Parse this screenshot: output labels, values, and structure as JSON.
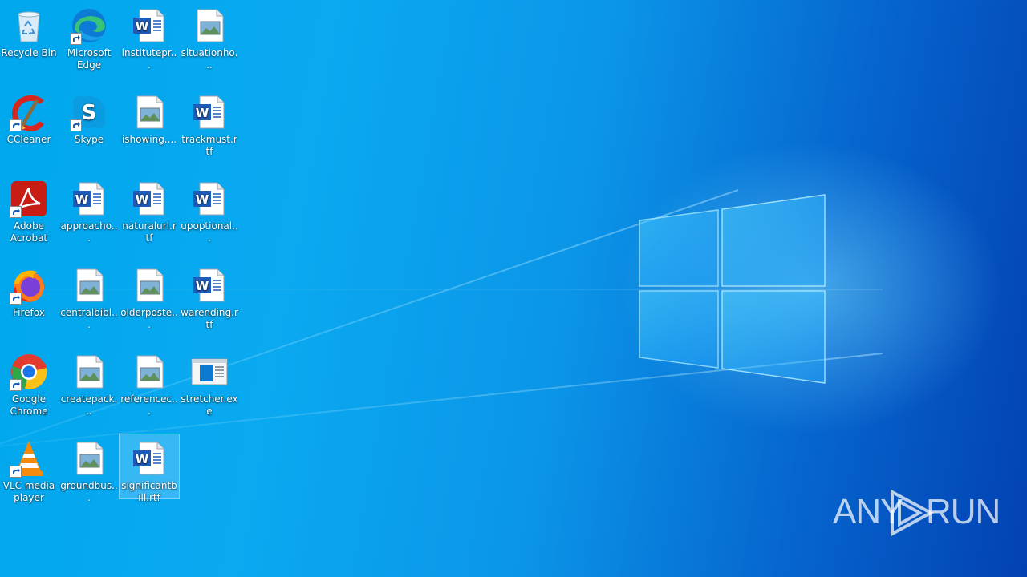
{
  "desktop": {
    "icons": [
      {
        "label": "Recycle Bin",
        "icon": "recycle-bin-icon",
        "shortcut": false
      },
      {
        "label": "Microsoft Edge",
        "icon": "edge-icon",
        "shortcut": true
      },
      {
        "label": "institutepr...",
        "icon": "word-rtf-icon",
        "shortcut": false
      },
      {
        "label": "situationho...",
        "icon": "image-file-icon",
        "shortcut": false
      },
      {
        "label": "CCleaner",
        "icon": "ccleaner-icon",
        "shortcut": true
      },
      {
        "label": "Skype",
        "icon": "skype-icon",
        "shortcut": true
      },
      {
        "label": "ishowing....",
        "icon": "image-file-icon",
        "shortcut": false
      },
      {
        "label": "trackmust.rtf",
        "icon": "word-rtf-icon",
        "shortcut": false
      },
      {
        "label": "Adobe Acrobat",
        "icon": "acrobat-icon",
        "shortcut": true
      },
      {
        "label": "approacho...",
        "icon": "word-rtf-icon",
        "shortcut": false
      },
      {
        "label": "naturalurl.rtf",
        "icon": "word-rtf-icon",
        "shortcut": false
      },
      {
        "label": "upoptional...",
        "icon": "word-rtf-icon",
        "shortcut": false
      },
      {
        "label": "Firefox",
        "icon": "firefox-icon",
        "shortcut": true
      },
      {
        "label": "centralbibl...",
        "icon": "image-file-icon",
        "shortcut": false
      },
      {
        "label": "olderposte...",
        "icon": "image-file-icon",
        "shortcut": false
      },
      {
        "label": "warending.rtf",
        "icon": "word-rtf-icon",
        "shortcut": false
      },
      {
        "label": "Google Chrome",
        "icon": "chrome-icon",
        "shortcut": true
      },
      {
        "label": "createpack...",
        "icon": "image-file-icon",
        "shortcut": false
      },
      {
        "label": "referencec...",
        "icon": "image-file-icon",
        "shortcut": false
      },
      {
        "label": "stretcher.exe",
        "icon": "exe-window-icon",
        "shortcut": false
      },
      {
        "label": "VLC media player",
        "icon": "vlc-icon",
        "shortcut": true
      },
      {
        "label": "groundbus...",
        "icon": "image-file-icon",
        "shortcut": false
      },
      {
        "label": "significantbill.rtf",
        "icon": "word-rtf-icon",
        "shortcut": false,
        "selected": true
      }
    ]
  },
  "watermark": {
    "left": "ANY",
    "right": "RUN"
  },
  "colors": {
    "wallpaper_light": "#00a8ee",
    "wallpaper_dark": "#0341b3",
    "word_blue": "#1f5bb8"
  }
}
